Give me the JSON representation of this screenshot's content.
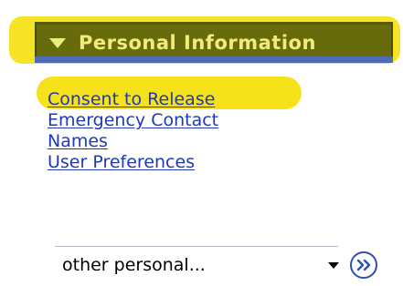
{
  "header": {
    "title": "Personal Information",
    "expand_icon": "triangle-down-icon"
  },
  "links": [
    {
      "label": "Consent to Release"
    },
    {
      "label": "Emergency Contact"
    },
    {
      "label": "Names"
    },
    {
      "label": "User Preferences"
    }
  ],
  "dropdown": {
    "selected": "other personal...",
    "arrow_icon": "caret-down-icon"
  },
  "go_button": {
    "icon": "double-chevron-right-icon"
  },
  "colors": {
    "header_bg": "#676b0c",
    "header_text": "#f0ec7a",
    "highlight": "#f6e21a",
    "link": "#1e39b5",
    "accent_bar": "#4e6bb8"
  }
}
